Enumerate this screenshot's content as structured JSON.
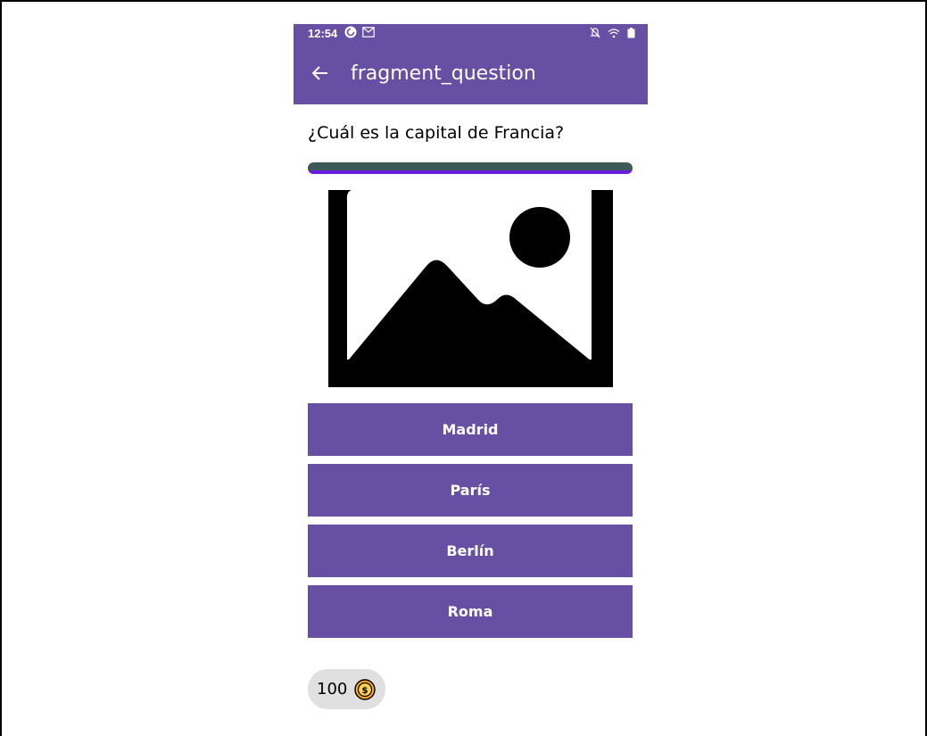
{
  "status_bar": {
    "time": "12:54",
    "icons_left": [
      "pocket-casts-icon",
      "gmail-icon"
    ],
    "icons_right": [
      "mute-icon",
      "wifi-icon",
      "battery-icon"
    ]
  },
  "app_bar": {
    "back_icon": "arrow-back-icon",
    "title": "fragment_question"
  },
  "question": {
    "text": "¿Cuál es la capital de Francia?",
    "progress_fraction": 1.0
  },
  "image": {
    "icon": "image-placeholder-icon"
  },
  "answers": [
    {
      "label": "Madrid"
    },
    {
      "label": "París"
    },
    {
      "label": "Berlín"
    },
    {
      "label": "Roma"
    }
  ],
  "coins": {
    "count": "100",
    "icon": "coin-icon"
  },
  "colors": {
    "primary": "#6750a4",
    "progress_track": "#3e5a56",
    "progress_indicator": "#6a1bdc",
    "coin_badge_bg": "#e0e0e0"
  }
}
